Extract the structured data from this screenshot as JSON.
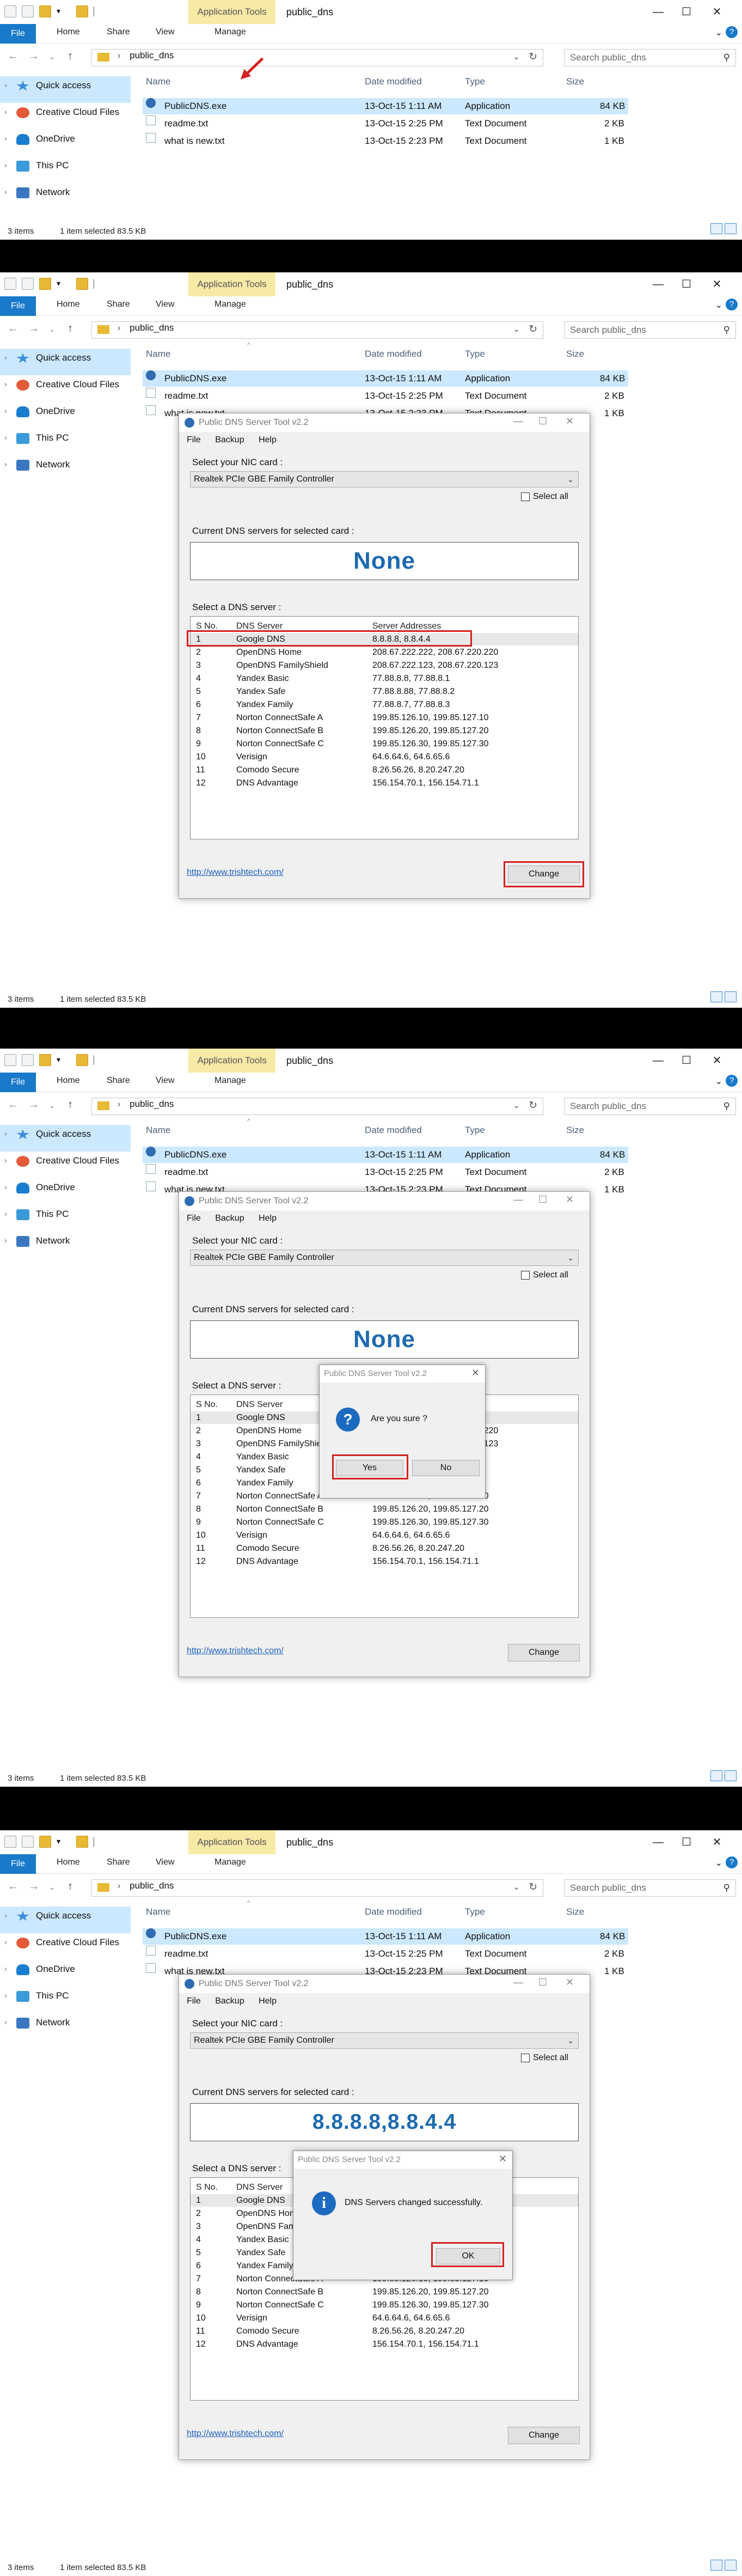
{
  "explorer": {
    "context_tab": "Application Tools",
    "folder_title": "public_dns",
    "ribbon_tabs": [
      "File",
      "Home",
      "Share",
      "View",
      "Manage"
    ],
    "address_path": "public_dns",
    "search_placeholder": "Search public_dns",
    "nav": [
      "Quick access",
      "Creative Cloud Files",
      "OneDrive",
      "This PC",
      "Network"
    ],
    "columns": [
      "Name",
      "Date modified",
      "Type",
      "Size"
    ],
    "files": [
      {
        "name": "PublicDNS.exe",
        "date": "13-Oct-15 1:11 AM",
        "type": "Application",
        "size": "84 KB"
      },
      {
        "name": "readme.txt",
        "date": "13-Oct-15 2:25 PM",
        "type": "Text Document",
        "size": "2 KB"
      },
      {
        "name": "what is new.txt",
        "date": "13-Oct-15 2:23 PM",
        "type": "Text Document",
        "size": "1 KB"
      }
    ],
    "status_items": "3 items",
    "status_selected": "1 item selected  83.5 KB"
  },
  "app": {
    "title": "Public DNS Server Tool v2.2",
    "menu": [
      "File",
      "Backup",
      "Help"
    ],
    "nic_label": "Select your NIC card :",
    "nic_value": "Realtek PCIe GBE Family Controller",
    "select_all": "Select all",
    "current_label": "Current DNS servers for selected card :",
    "current_none": "None",
    "current_set": "8.8.8.8,8.8.4.4",
    "list_label": "Select a DNS server :",
    "list_headers": [
      "S No.",
      "DNS Server",
      "Server Addresses"
    ],
    "servers": [
      {
        "no": "1",
        "name": "Google DNS",
        "addr": "8.8.8.8, 8.8.4.4"
      },
      {
        "no": "2",
        "name": "OpenDNS Home",
        "addr": "208.67.222.222, 208.67.220.220"
      },
      {
        "no": "3",
        "name": "OpenDNS FamilyShield",
        "addr": "208.67.222.123, 208.67.220.123"
      },
      {
        "no": "4",
        "name": "Yandex Basic",
        "addr": "77.88.8.8, 77.88.8.1"
      },
      {
        "no": "5",
        "name": "Yandex Safe",
        "addr": "77.88.8.88, 77.88.8.2"
      },
      {
        "no": "6",
        "name": "Yandex Family",
        "addr": "77.88.8.7, 77.88.8.3"
      },
      {
        "no": "7",
        "name": "Norton ConnectSafe A",
        "addr": "199.85.126.10, 199.85.127.10"
      },
      {
        "no": "8",
        "name": "Norton ConnectSafe B",
        "addr": "199.85.126.20, 199.85.127.20"
      },
      {
        "no": "9",
        "name": "Norton ConnectSafe C",
        "addr": "199.85.126.30, 199.85.127.30"
      },
      {
        "no": "10",
        "name": "Verisign",
        "addr": "64.6.64.6, 64.6.65.6"
      },
      {
        "no": "11",
        "name": "Comodo Secure",
        "addr": "8.26.56.26, 8.20.247.20"
      },
      {
        "no": "12",
        "name": "DNS Advantage",
        "addr": "156.154.70.1, 156.154.71.1"
      }
    ],
    "link": "http://www.trishtech.com/",
    "change_button": "Change"
  },
  "confirm_dialog": {
    "title": "Public DNS Server Tool v2.2",
    "message": "Are you sure ?",
    "yes": "Yes",
    "no": "No",
    "icon": "question-icon"
  },
  "info_dialog": {
    "title": "Public DNS Server Tool v2.2",
    "message": "DNS Servers changed successfully.",
    "ok": "OK",
    "icon": "info-icon"
  },
  "colors": {
    "accent": "#1979ca",
    "highlight_red": "#d42020",
    "dns_text": "#1d6ab0",
    "selection": "#cce8ff",
    "context_tab": "#f7e9a6"
  }
}
